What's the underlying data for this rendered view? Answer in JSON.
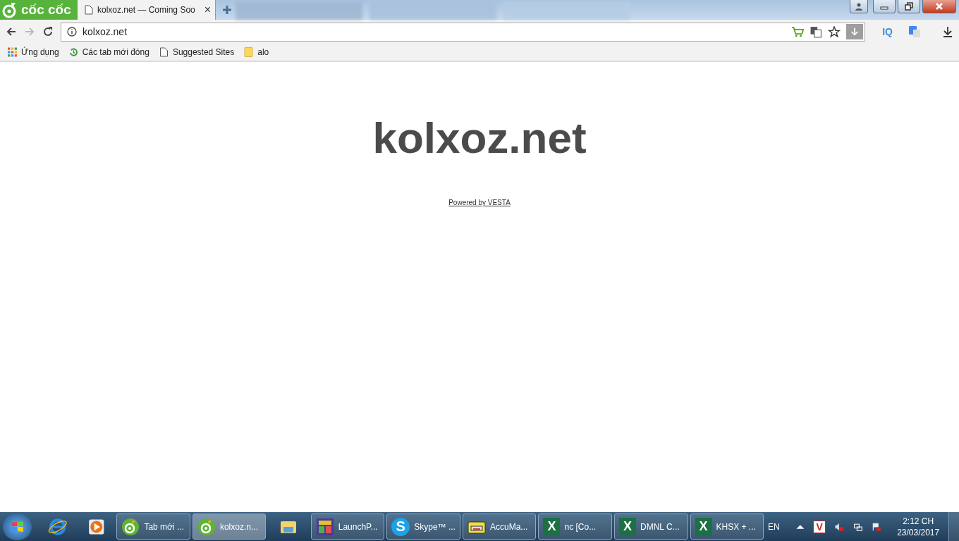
{
  "browser": {
    "logo": "cốc cốc",
    "tabs": [
      {
        "title": "kolxoz.net — Coming Soo",
        "selected": true,
        "close": "×"
      }
    ],
    "address": "kolxoz.net",
    "bookmarks": [
      {
        "kind": "apps",
        "label": "Ứng dụng"
      },
      {
        "kind": "history",
        "label": "Các tab mới đóng"
      },
      {
        "kind": "page",
        "label": "Suggested Sites"
      },
      {
        "kind": "folder",
        "label": "alo"
      }
    ],
    "extensions": [
      {
        "label": "IQ"
      }
    ]
  },
  "page": {
    "heading": "kolxoz.net",
    "link": "Powered by VESTA"
  },
  "taskbar": {
    "items": [
      {
        "kind": "coccoc",
        "label": "Tab mới ...",
        "selected": false
      },
      {
        "kind": "coccoc",
        "label": "kolxoz.n...",
        "selected": true
      },
      {
        "kind": "explorer"
      },
      {
        "kind": "launch",
        "label": "LaunchP...",
        "selected": false
      },
      {
        "kind": "skype",
        "label": "Skype™ ...",
        "selected": false,
        "glyph": "S"
      },
      {
        "kind": "folder",
        "label": "AccuMa...",
        "selected": false
      },
      {
        "kind": "excel",
        "label": "nc  [Co...",
        "selected": false,
        "glyph": "X"
      },
      {
        "kind": "excel",
        "label": "DMNL C...",
        "selected": false,
        "glyph": "X"
      },
      {
        "kind": "excel",
        "label": "KHSX + ...",
        "selected": false,
        "glyph": "X"
      }
    ],
    "language": "EN",
    "time": "2:12 CH",
    "date": "23/03/2017",
    "tray_glyph": "V"
  }
}
